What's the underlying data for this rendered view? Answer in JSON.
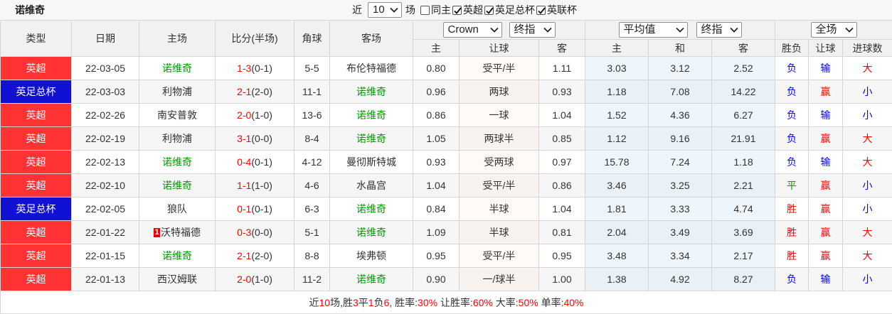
{
  "team": "诺维奇",
  "filter": {
    "recent_prefix": "近",
    "count": "10",
    "games_suffix": "场",
    "options": [
      {
        "label": "同主",
        "checked": false
      },
      {
        "label": "英超",
        "checked": true
      },
      {
        "label": "英足总杯",
        "checked": true
      },
      {
        "label": "英联杯",
        "checked": true
      }
    ]
  },
  "header": {
    "type": "类型",
    "date": "日期",
    "home": "主场",
    "score": "比分(半场)",
    "corners": "角球",
    "away": "客场",
    "odds_company": "Crown",
    "odds_stage": "终指",
    "avg_label": "平均值",
    "avg_stage": "终指",
    "scope": "全场",
    "sub": {
      "odds_home": "主",
      "handicap": "让球",
      "odds_away": "客",
      "avg_home": "主",
      "avg_draw": "和",
      "avg_away": "客",
      "result": "胜负",
      "handicap_result": "让球",
      "goals": "进球数"
    }
  },
  "colors": {
    "highlight_team": "#009900",
    "score": "#ff0000",
    "summary_value": "#ff0000",
    "league": {
      "英超": "#ff3333",
      "英足总杯": "#1111d4"
    },
    "result": {
      "胜": "#ff0000",
      "平": "#009900",
      "负": "#0000ff",
      "赢": "#ff0000",
      "输": "#0000ff",
      "大": "#ff0000",
      "小": "#0000ff"
    }
  },
  "rows": [
    {
      "league": "英超",
      "date": "22-03-05",
      "home": "诺维奇",
      "score": "1-3",
      "half": "(0-1)",
      "corners": "5-5",
      "away": "布伦特福德",
      "crown": {
        "home": "0.80",
        "handicap": "受平/半",
        "away": "1.11"
      },
      "avg": {
        "home": "3.03",
        "draw": "3.12",
        "away": "2.52"
      },
      "result": "负",
      "handicap_result": "输",
      "goals": "大"
    },
    {
      "league": "英足总杯",
      "date": "22-03-03",
      "home": "利物浦",
      "score": "2-1",
      "half": "(2-0)",
      "corners": "11-1",
      "away": "诺维奇",
      "crown": {
        "home": "0.96",
        "handicap": "两球",
        "away": "0.93"
      },
      "avg": {
        "home": "1.18",
        "draw": "7.08",
        "away": "14.22"
      },
      "result": "负",
      "handicap_result": "赢",
      "goals": "小"
    },
    {
      "league": "英超",
      "date": "22-02-26",
      "home": "南安普敦",
      "score": "2-0",
      "half": "(1-0)",
      "corners": "13-6",
      "away": "诺维奇",
      "crown": {
        "home": "0.86",
        "handicap": "一球",
        "away": "1.04"
      },
      "avg": {
        "home": "1.52",
        "draw": "4.36",
        "away": "6.27"
      },
      "result": "负",
      "handicap_result": "输",
      "goals": "小"
    },
    {
      "league": "英超",
      "date": "22-02-19",
      "home": "利物浦",
      "score": "3-1",
      "half": "(0-0)",
      "corners": "8-4",
      "away": "诺维奇",
      "crown": {
        "home": "1.05",
        "handicap": "两球半",
        "away": "0.85"
      },
      "avg": {
        "home": "1.12",
        "draw": "9.16",
        "away": "21.91"
      },
      "result": "负",
      "handicap_result": "赢",
      "goals": "大"
    },
    {
      "league": "英超",
      "date": "22-02-13",
      "home": "诺维奇",
      "score": "0-4",
      "half": "(0-1)",
      "corners": "4-12",
      "away": "曼彻斯特城",
      "crown": {
        "home": "0.93",
        "handicap": "受两球",
        "away": "0.97"
      },
      "avg": {
        "home": "15.78",
        "draw": "7.24",
        "away": "1.18"
      },
      "result": "负",
      "handicap_result": "输",
      "goals": "大"
    },
    {
      "league": "英超",
      "date": "22-02-10",
      "home": "诺维奇",
      "score": "1-1",
      "half": "(1-0)",
      "corners": "4-6",
      "away": "水晶宫",
      "crown": {
        "home": "1.04",
        "handicap": "受平/半",
        "away": "0.86"
      },
      "avg": {
        "home": "3.46",
        "draw": "3.25",
        "away": "2.21"
      },
      "result": "平",
      "handicap_result": "赢",
      "goals": "小"
    },
    {
      "league": "英足总杯",
      "date": "22-02-05",
      "home": "狼队",
      "score": "0-1",
      "half": "(0-1)",
      "corners": "6-3",
      "away": "诺维奇",
      "crown": {
        "home": "0.84",
        "handicap": "半球",
        "away": "1.04"
      },
      "avg": {
        "home": "1.81",
        "draw": "3.33",
        "away": "4.74"
      },
      "result": "胜",
      "handicap_result": "赢",
      "goals": "小"
    },
    {
      "league": "英超",
      "date": "22-01-22",
      "home": "沃特福德",
      "home_red_card": "1",
      "score": "0-3",
      "half": "(0-0)",
      "corners": "5-1",
      "away": "诺维奇",
      "crown": {
        "home": "1.09",
        "handicap": "半球",
        "away": "0.81"
      },
      "avg": {
        "home": "2.04",
        "draw": "3.49",
        "away": "3.69"
      },
      "result": "胜",
      "handicap_result": "赢",
      "goals": "大"
    },
    {
      "league": "英超",
      "date": "22-01-15",
      "home": "诺维奇",
      "score": "2-1",
      "half": "(2-0)",
      "corners": "8-8",
      "away": "埃弗顿",
      "crown": {
        "home": "0.95",
        "handicap": "受平/半",
        "away": "0.95"
      },
      "avg": {
        "home": "3.48",
        "draw": "3.34",
        "away": "2.17"
      },
      "result": "胜",
      "handicap_result": "赢",
      "goals": "大"
    },
    {
      "league": "英超",
      "date": "22-01-13",
      "home": "西汉姆联",
      "score": "2-0",
      "half": "(1-0)",
      "corners": "11-2",
      "away": "诺维奇",
      "crown": {
        "home": "0.90",
        "handicap": "一/球半",
        "away": "1.00"
      },
      "avg": {
        "home": "1.38",
        "draw": "4.92",
        "away": "8.27"
      },
      "result": "负",
      "handicap_result": "输",
      "goals": "小"
    }
  ],
  "footer": {
    "segments": [
      {
        "t": "近",
        "hl": false
      },
      {
        "t": "10",
        "hl": true
      },
      {
        "t": "场,胜",
        "hl": false
      },
      {
        "t": "3",
        "hl": true
      },
      {
        "t": "平",
        "hl": false
      },
      {
        "t": "1",
        "hl": true
      },
      {
        "t": "负",
        "hl": false
      },
      {
        "t": "6",
        "hl": true
      },
      {
        "t": ", 胜率:",
        "hl": false
      },
      {
        "t": "30%",
        "hl": true
      },
      {
        "t": " 让胜率:",
        "hl": false
      },
      {
        "t": "60%",
        "hl": true
      },
      {
        "t": " 大率:",
        "hl": false
      },
      {
        "t": "50%",
        "hl": true
      },
      {
        "t": " 单率:",
        "hl": false
      },
      {
        "t": "40%",
        "hl": true
      }
    ]
  }
}
